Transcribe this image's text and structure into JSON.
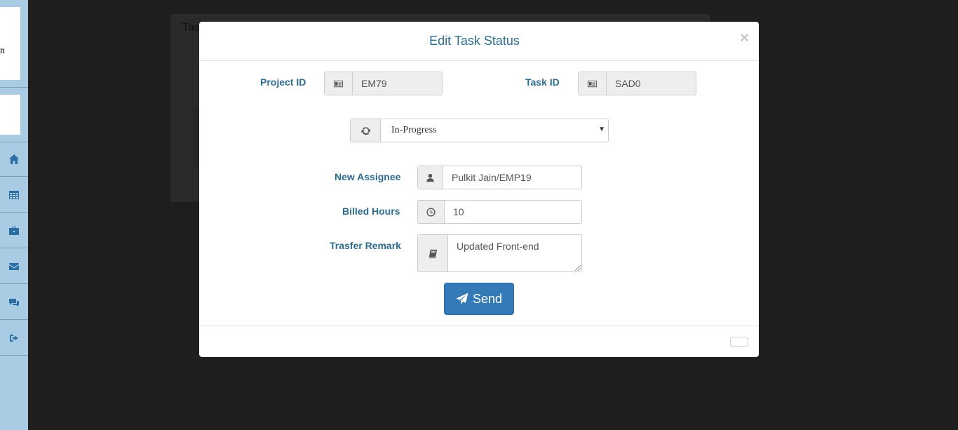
{
  "sidebar": {
    "logo_text": "n",
    "items": [
      {
        "icon": "home-icon"
      },
      {
        "icon": "table-icon"
      },
      {
        "icon": "briefcase-icon"
      },
      {
        "icon": "envelope-icon"
      },
      {
        "icon": "comments-icon"
      },
      {
        "icon": "sign-out-icon"
      }
    ]
  },
  "background": {
    "panel_title": "Tas"
  },
  "modal": {
    "title": "Edit Task Status",
    "close_label": "×",
    "project_id_label": "Project ID",
    "project_id_value": "EM79",
    "task_id_label": "Task ID",
    "task_id_value": "SAD0",
    "status_selected": "In-Progress",
    "new_assignee_label": "New Assignee",
    "new_assignee_value": "Pulkit Jain/EMP19",
    "billed_hours_label": "Billed Hours",
    "billed_hours_value": "10",
    "transfer_remark_label": "Trasfer Remark",
    "transfer_remark_value": "Updated Front-end",
    "send_label": "Send"
  },
  "colors": {
    "sidebar_bg": "#a9cbe3",
    "label_color": "#2e6d8f",
    "primary_button": "#337ab7",
    "backdrop": "#1e1e1e"
  }
}
